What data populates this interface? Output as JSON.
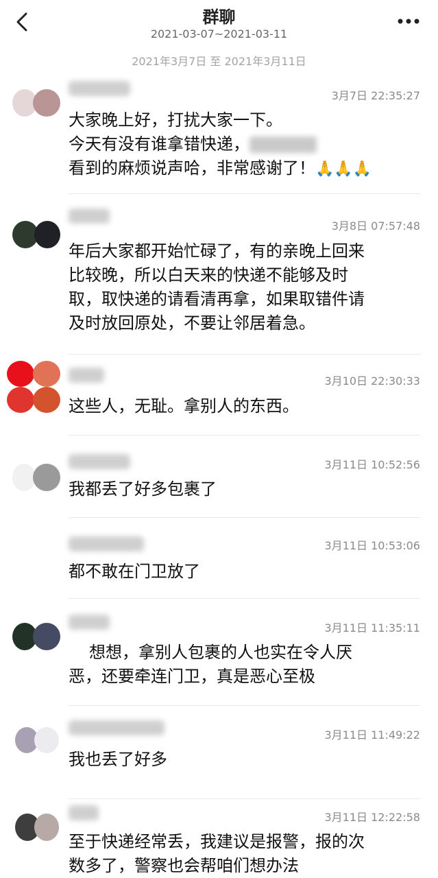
{
  "header": {
    "back_icon": "chevron-left-icon",
    "title": "群聊",
    "subtitle": "2021-03-07~2021-03-11",
    "more_icon": "more-dots-icon"
  },
  "date_range": "2021年3月7日 至 2021年3月11日",
  "messages": [
    {
      "time": "3月7日 22:35:27",
      "lines": [
        "大家晚上好，打扰大家一下。",
        "今天有没有谁拿错快递，",
        "看到的麻烦说声哈，非常感谢了！"
      ],
      "emoji": "🙏🙏🙏"
    },
    {
      "time": "3月8日 07:57:48",
      "lines": [
        "年后大家都开始忙碌了，有的亲晚上回来",
        "比较晚，所以白天来的快递不能够及时",
        "取，取快递的请看清再拿，如果取错件请",
        "及时放回原处，不要让邻居着急。"
      ]
    },
    {
      "time": "3月10日 22:30:33",
      "lines": [
        "这些人，无耻。拿别人的东西。"
      ]
    },
    {
      "time": "3月11日 10:52:56",
      "lines": [
        "我都丢了好多包裹了"
      ]
    },
    {
      "time": "3月11日 10:53:06",
      "lines": [
        "都不敢在门卫放了"
      ]
    },
    {
      "time": "3月11日 11:35:11",
      "lines": [
        "想想，拿别人包裹的人也实在令人厌",
        "恶，还要牵连门卫，真是恶心至极"
      ]
    },
    {
      "time": "3月11日 11:49:22",
      "lines": [
        "我也丢了好多"
      ]
    },
    {
      "time": "3月11日 12:22:58",
      "lines": [
        "至于快递经常丢，我建议是报警，报的次",
        "数多了，警察也会帮咱们想办法"
      ]
    }
  ],
  "colors": {
    "accent_red": "#e0362b",
    "text": "#111111",
    "muted": "#8a8a8a"
  }
}
